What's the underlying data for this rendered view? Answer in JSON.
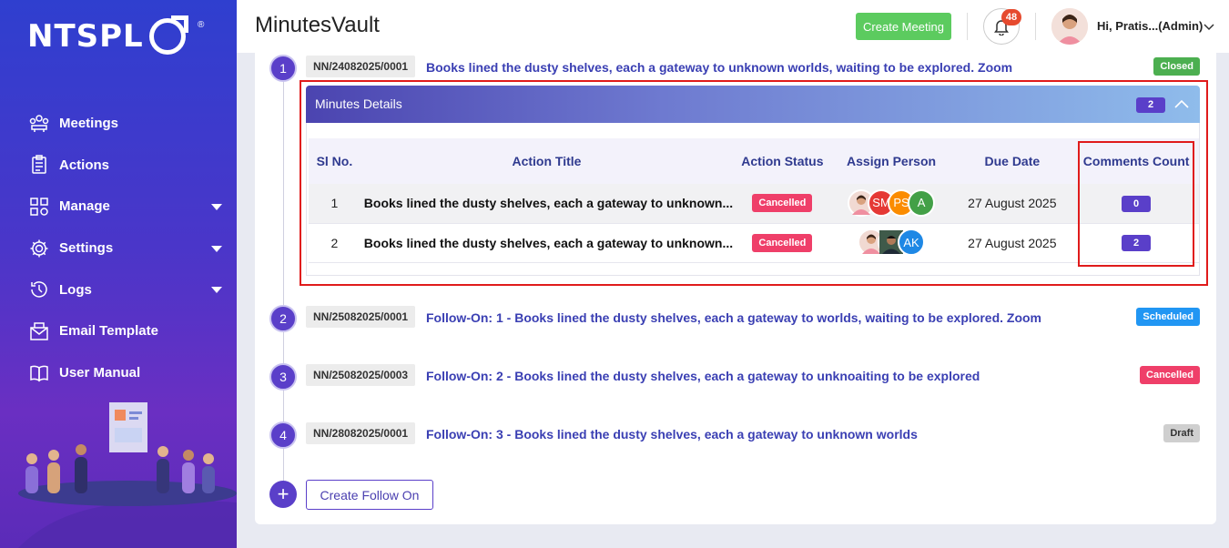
{
  "sidebar": {
    "logo_text": "NTSPL",
    "logo_reg": "®",
    "items": [
      {
        "label": "Meetings",
        "icon": "meetings-icon",
        "has_caret": false
      },
      {
        "label": "Actions",
        "icon": "actions-icon",
        "has_caret": false
      },
      {
        "label": "Manage",
        "icon": "manage-icon",
        "has_caret": true
      },
      {
        "label": "Settings",
        "icon": "gear-icon",
        "has_caret": true
      },
      {
        "label": "Logs",
        "icon": "history-icon",
        "has_caret": true
      },
      {
        "label": "Email Template",
        "icon": "email-icon",
        "has_caret": false
      },
      {
        "label": "User Manual",
        "icon": "book-icon",
        "has_caret": false
      }
    ]
  },
  "header": {
    "title": "MinutesVault",
    "create_meeting_label": "Create Meeting",
    "notification_count": "48",
    "user_greeting": "Hi, Pratis...(Admin)"
  },
  "meetings": [
    {
      "step": "1",
      "number": "NN/24082025/0001",
      "title": "Books lined the dusty shelves, each a gateway to unknown worlds, waiting to be explored. Zoom",
      "status": "Closed",
      "status_color": "#4caf50"
    },
    {
      "step": "2",
      "number": "NN/25082025/0001",
      "title": "Follow-On: 1 - Books lined the dusty shelves, each a gateway to worlds, waiting to be explored. Zoom",
      "status": "Scheduled",
      "status_color": "#2196f3"
    },
    {
      "step": "3",
      "number": "NN/25082025/0003",
      "title": "Follow-On: 2 - Books lined the dusty shelves, each a gateway to unknoaiting to be explored",
      "status": "Cancelled",
      "status_color": "#ef3f69"
    },
    {
      "step": "4",
      "number": "NN/28082025/0001",
      "title": "Follow-On: 3 - Books lined the dusty shelves, each a gateway to unknown worlds",
      "status": "Draft",
      "status_color": "#c9c9c9"
    }
  ],
  "minutes": {
    "title": "Minutes Details",
    "count": "2",
    "columns": [
      "Sl No.",
      "Action Title",
      "Action Status",
      "Assign Person",
      "Due Date",
      "Comments Count"
    ],
    "rows": [
      {
        "sl": "1",
        "title": "Books lined the dusty shelves, each a gateway to unknown...",
        "status": "Cancelled",
        "assignees": [
          {
            "initials": "",
            "color": "#f1d9d2",
            "photo": true
          },
          {
            "initials": "SM",
            "color": "#e53935"
          },
          {
            "initials": "PS",
            "color": "#fb8c00"
          },
          {
            "initials": "A",
            "color": "#43a047"
          }
        ],
        "due_date": "27 August 2025",
        "comments": "0"
      },
      {
        "sl": "2",
        "title": "Books lined the dusty shelves, each a gateway to unknown...",
        "status": "Cancelled",
        "assignees": [
          {
            "initials": "",
            "color": "#f1d9d2",
            "photo": true
          },
          {
            "initials": "",
            "color": "#3b4a5a",
            "photo": true
          },
          {
            "initials": "AK",
            "color": "#1e88e5"
          }
        ],
        "due_date": "27 August 2025",
        "comments": "2"
      }
    ]
  },
  "create_follow_on_label": "Create Follow On"
}
